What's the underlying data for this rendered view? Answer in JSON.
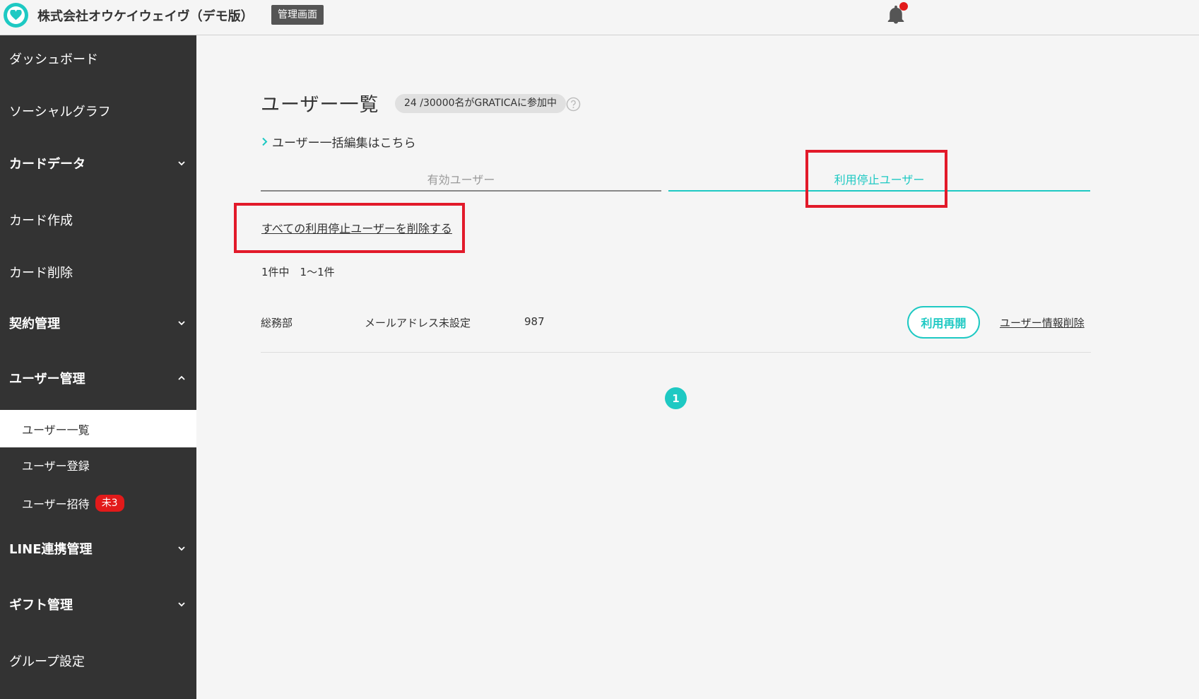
{
  "header": {
    "company": "株式会社オウケイウェイヴ（デモ版）",
    "admin_badge": "管理画面"
  },
  "sidebar": {
    "items": [
      {
        "label": "ダッシュボード"
      },
      {
        "label": "ソーシャルグラフ"
      },
      {
        "label": "カードデータ"
      },
      {
        "label": "カード作成"
      },
      {
        "label": "カード削除"
      },
      {
        "label": "契約管理"
      },
      {
        "label": "ユーザー管理"
      },
      {
        "label": "LINE連携管理"
      },
      {
        "label": "ギフト管理"
      },
      {
        "label": "グループ設定"
      }
    ],
    "subitems": [
      {
        "label": "ユーザー一覧"
      },
      {
        "label": "ユーザー登録"
      },
      {
        "label": "ユーザー招待",
        "badge": "未3"
      }
    ]
  },
  "main": {
    "title": "ユーザー一覧",
    "count_text": "24 /30000名がGRATICAに参加中",
    "bulk_edit_link": "ユーザー一括編集はこちら",
    "tabs": [
      {
        "label": "有効ユーザー"
      },
      {
        "label": "利用停止ユーザー"
      }
    ],
    "delete_all_link": "すべての利用停止ユーザーを削除する",
    "range_text": "1件中　1〜1件",
    "rows": [
      {
        "department": "総務部",
        "email": "メールアドレス未設定",
        "id": "987",
        "resume_label": "利用再開",
        "delete_label": "ユーザー情報削除"
      }
    ],
    "pagination": {
      "current": "1"
    }
  },
  "colors": {
    "accent": "#1ec9c3",
    "sidebar": "#333333",
    "highlight": "#e21a2a",
    "badge": "#e21a1a"
  }
}
